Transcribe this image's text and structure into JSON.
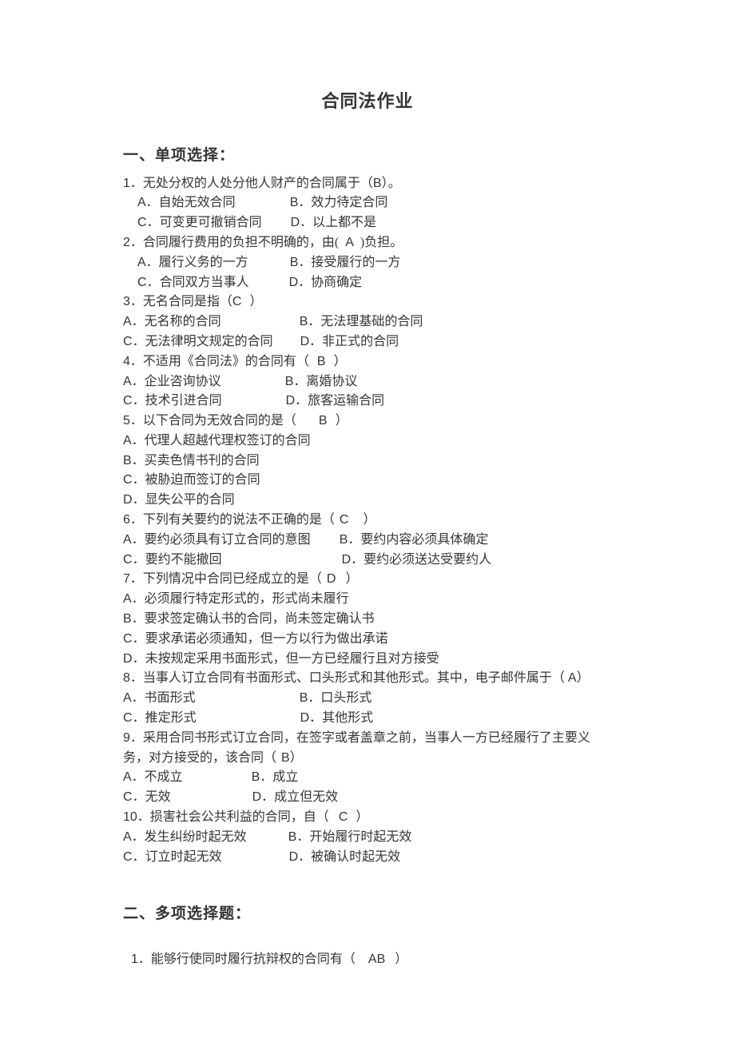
{
  "title": "合同法作业",
  "section1": {
    "heading": "一、单项选择：",
    "questions": [
      {
        "num": "1",
        "prompt_prefix": "．无处分权的人处分他人财产的合同属于（",
        "answer": "B",
        "prompt_suffix": "）。",
        "option_lines": [
          {
            "indent": true,
            "items": [
              {
                "letter": "A",
                "sep": "．",
                "text": "自始无效合同",
                "gap": 68
              },
              {
                "letter": "B",
                "sep": "．",
                "text": "效力待定合同"
              }
            ]
          },
          {
            "indent": true,
            "items": [
              {
                "letter": "C",
                "sep": "．",
                "text": "可变更可撤销合同",
                "gap": 36
              },
              {
                "letter": "D",
                "sep": "．",
                "text": "以上都不是"
              }
            ]
          }
        ]
      },
      {
        "num": "2",
        "prompt_prefix": "．合同履行费用的负担不明确的，由(",
        "answer_gap_pre": 8,
        "answer": "A",
        "answer_gap_post": 8,
        "prompt_suffix": ")负担。",
        "option_lines": [
          {
            "indent": true,
            "items": [
              {
                "letter": "A",
                "sep": "．",
                "text": "履行义务的一方",
                "gap": 52
              },
              {
                "letter": "B",
                "sep": "．",
                "text": "接受履行的一方"
              }
            ]
          },
          {
            "indent": true,
            "half": true,
            "items": [
              {
                "letter": "C",
                "sep": "．",
                "text": "合同双方当事人",
                "gap": 50
              },
              {
                "letter": "D",
                "sep": "．",
                "text": "协商确定"
              }
            ]
          }
        ]
      },
      {
        "num": "3",
        "prompt_prefix": "．无名合同是指（",
        "answer": "C",
        "answer_gap_post": 10,
        "prompt_suffix": "）",
        "option_lines": [
          {
            "items": [
              {
                "letter": "A",
                "sep": "．",
                "text": "无名称的合同",
                "gap": 98
              },
              {
                "letter": "B",
                "sep": "．",
                "text": "无法理基础的合同"
              }
            ]
          },
          {
            "items": [
              {
                "letter": "C",
                "sep": "．",
                "text": "无法律明文规定的合同",
                "gap": 34
              },
              {
                "letter": "D",
                "sep": "．",
                "text": "非正式的合同"
              }
            ]
          }
        ]
      },
      {
        "num": "4",
        "prompt_prefix": "．不适用《合同法》的合同有（",
        "answer_gap_pre": 10,
        "answer": "B",
        "answer_gap_post": 10,
        "prompt_suffix": "）",
        "option_lines": [
          {
            "items": [
              {
                "letter": "A",
                "sep": "．",
                "text": "企业咨询协议",
                "gap": 80
              },
              {
                "letter": "B",
                "sep": "．",
                "text": "离婚协议"
              }
            ]
          },
          {
            "items": [
              {
                "letter": "C",
                "sep": "．",
                "text": "技术引进合同",
                "gap": 80
              },
              {
                "letter": "D",
                "sep": "．",
                "text": "旅客运输合同"
              }
            ]
          }
        ]
      },
      {
        "num": "5",
        "prompt_prefix": "．以下合同为无效合同的是（",
        "answer_gap_pre": 28,
        "answer": "B",
        "answer_gap_post": 10,
        "prompt_suffix": "）",
        "option_lines": [
          {
            "items": [
              {
                "letter": "A",
                "sep": "．",
                "text": "代理人超越代理权签订的合同"
              }
            ]
          },
          {
            "items": [
              {
                "letter": "B",
                "sep": "．",
                "text": "买卖色情书刊的合同"
              }
            ]
          },
          {
            "items": [
              {
                "letter": "C",
                "sep": "．",
                "text": "被胁迫而签订的合同"
              }
            ]
          },
          {
            "items": [
              {
                "letter": "D",
                "sep": "．",
                "text": "显失公平的合同"
              }
            ]
          }
        ]
      },
      {
        "num": "6",
        "prompt_prefix": "．下列有关要约的说法不正确的是（",
        "answer_gap_pre": 6,
        "answer": "C",
        "answer_gap_post": 18,
        "prompt_suffix": "）",
        "option_lines": [
          {
            "items": [
              {
                "letter": "A",
                "sep": "．",
                "text": "要约必须具有订立合同的意图",
                "gap": 36
              },
              {
                "letter": "B",
                "sep": "．",
                "text": "要约内容必须具体确定"
              }
            ]
          },
          {
            "items": [
              {
                "letter": "C",
                "sep": "．",
                "text": "要约不能撤回",
                "gap": 150
              },
              {
                "letter": "D",
                "sep": "．",
                "text": "要约必须送达受要约人"
              }
            ]
          }
        ]
      },
      {
        "num": "7",
        "prompt_prefix": "．下列情况中合同已经成立的是（",
        "answer_gap_pre": 6,
        "answer": "D",
        "answer_gap_post": 12,
        "prompt_suffix": "）",
        "option_lines": [
          {
            "items": [
              {
                "letter": "A",
                "sep": "．",
                "text": "必须履行特定形式的，形式尚未履行"
              }
            ]
          },
          {
            "items": [
              {
                "letter": "B",
                "sep": "．",
                "text": "要求签定确认书的合同，尚未签定确认书"
              }
            ]
          },
          {
            "items": [
              {
                "letter": "C",
                "sep": "．",
                "text": "要求承诺必须通知，但一方以行为做出承诺"
              }
            ]
          },
          {
            "items": [
              {
                "letter": "D",
                "sep": "．",
                "text": "未按规定采用书面形式，但一方已经履行且对方接受"
              }
            ]
          }
        ]
      },
      {
        "num": "8",
        "prompt_prefix": "．当事人订立合同有书面形式、口头形式和其他形式。其中，电子邮件属于（",
        "answer_gap_pre": 4,
        "answer": "A",
        "prompt_suffix": "）",
        "option_lines": [
          {
            "items": [
              {
                "letter": "A",
                "sep": "．",
                "text": "书面形式",
                "gap": 130
              },
              {
                "letter": "B",
                "sep": "．",
                "text": "口头形式"
              }
            ]
          },
          {
            "items": [
              {
                "letter": "C",
                "sep": "．",
                "text": "推定形式",
                "gap": 130
              },
              {
                "letter": "D",
                "sep": "．",
                "text": "其他形式"
              }
            ]
          }
        ]
      },
      {
        "num": "9",
        "prompt_prefix": "．采用合同书形式订立合同，在签字或者盖章之前，当事人一方已经履行了主要义务，对方接受的，该合同（",
        "answer_gap_pre": 6,
        "answer": "B",
        "prompt_suffix": "）",
        "option_lines": [
          {
            "items": [
              {
                "letter": "A",
                "sep": "．",
                "text": "不成立",
                "gap": 86
              },
              {
                "letter": "B",
                "sep": "．",
                "text": "成立"
              }
            ]
          },
          {
            "items": [
              {
                "letter": "C",
                "sep": "．",
                "text": "无效",
                "gap": 102
              },
              {
                "letter": "D",
                "sep": "．",
                "text": "成立但无效"
              }
            ]
          }
        ]
      },
      {
        "num": "10",
        "prompt_prefix": "．损害社会公共利益的合同，自（",
        "answer_gap_pre": 12,
        "answer": "C",
        "answer_gap_post": 10,
        "prompt_suffix": "）",
        "option_lines": [
          {
            "items": [
              {
                "letter": "A",
                "sep": "．",
                "text": "发生纠纷时起无效",
                "gap": 52
              },
              {
                "letter": "B",
                "sep": "．",
                "text": "开始履行时起无效"
              }
            ]
          },
          {
            "items": [
              {
                "letter": "C",
                "sep": "．",
                "text": "订立时起无效",
                "gap": 84
              },
              {
                "letter": "D",
                "sep": "．",
                "text": "被确认时起无效"
              }
            ]
          }
        ]
      }
    ]
  },
  "section2": {
    "heading": "二、多项选择题：",
    "first": {
      "num": "1",
      "prompt_prefix": "．能够行使同时履行抗辩权的合同有（",
      "answer_gap_pre": 16,
      "answer": "AB",
      "answer_gap_post": 12,
      "prompt_suffix": "）"
    }
  }
}
